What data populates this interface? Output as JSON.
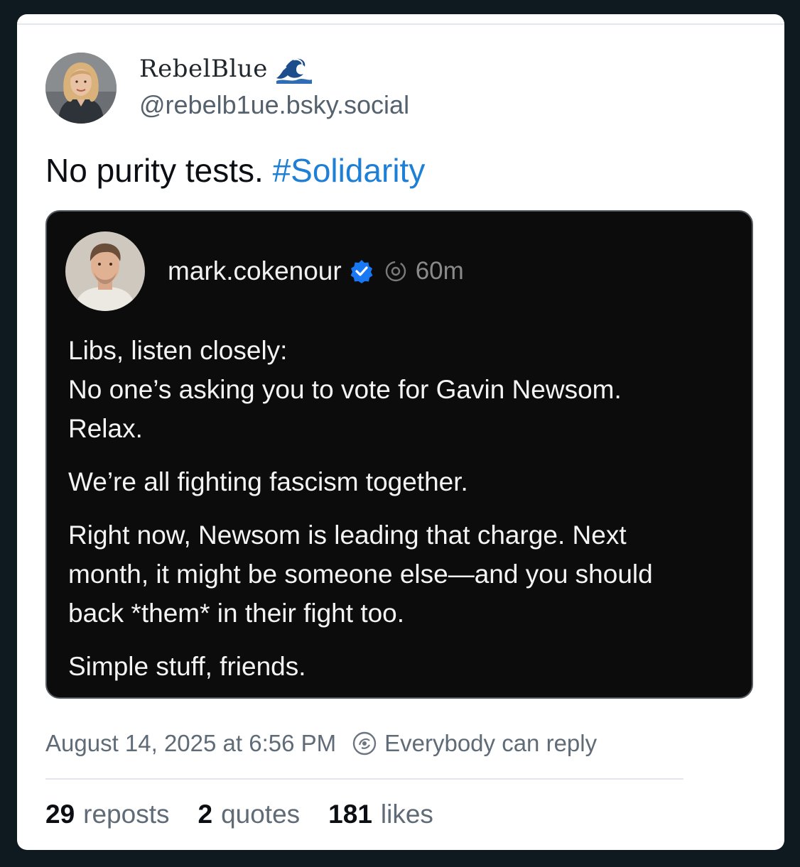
{
  "post": {
    "display_name": "RebelBlue",
    "name_icon": "wave-icon",
    "handle": "@rebelb1ue.bsky.social",
    "text": "No purity tests. ",
    "hashtag": "#Solidarity",
    "timestamp": "August 14, 2025 at 6:56 PM",
    "reply_setting": "Everybody can reply",
    "stats": [
      {
        "count": "29",
        "label": "reposts"
      },
      {
        "count": "2",
        "label": "quotes"
      },
      {
        "count": "181",
        "label": "likes"
      }
    ]
  },
  "quoted_post": {
    "author": "mark.cokenour",
    "verified": true,
    "time": "60m",
    "paragraphs": [
      [
        "Libs, listen closely:",
        "No one’s asking you to vote for Gavin Newsom.",
        "Relax."
      ],
      [
        "We’re all fighting fascism together."
      ],
      [
        "Right now, Newsom is leading that charge. Next",
        "month, it might be someone else—and you should",
        "back *them* in their fight too."
      ],
      [
        "Simple stuff, friends."
      ]
    ]
  },
  "colors": {
    "hashtag": "#1d7fd6",
    "verified_badge": "#1877f2",
    "quote_background": "#0c0c0c"
  }
}
